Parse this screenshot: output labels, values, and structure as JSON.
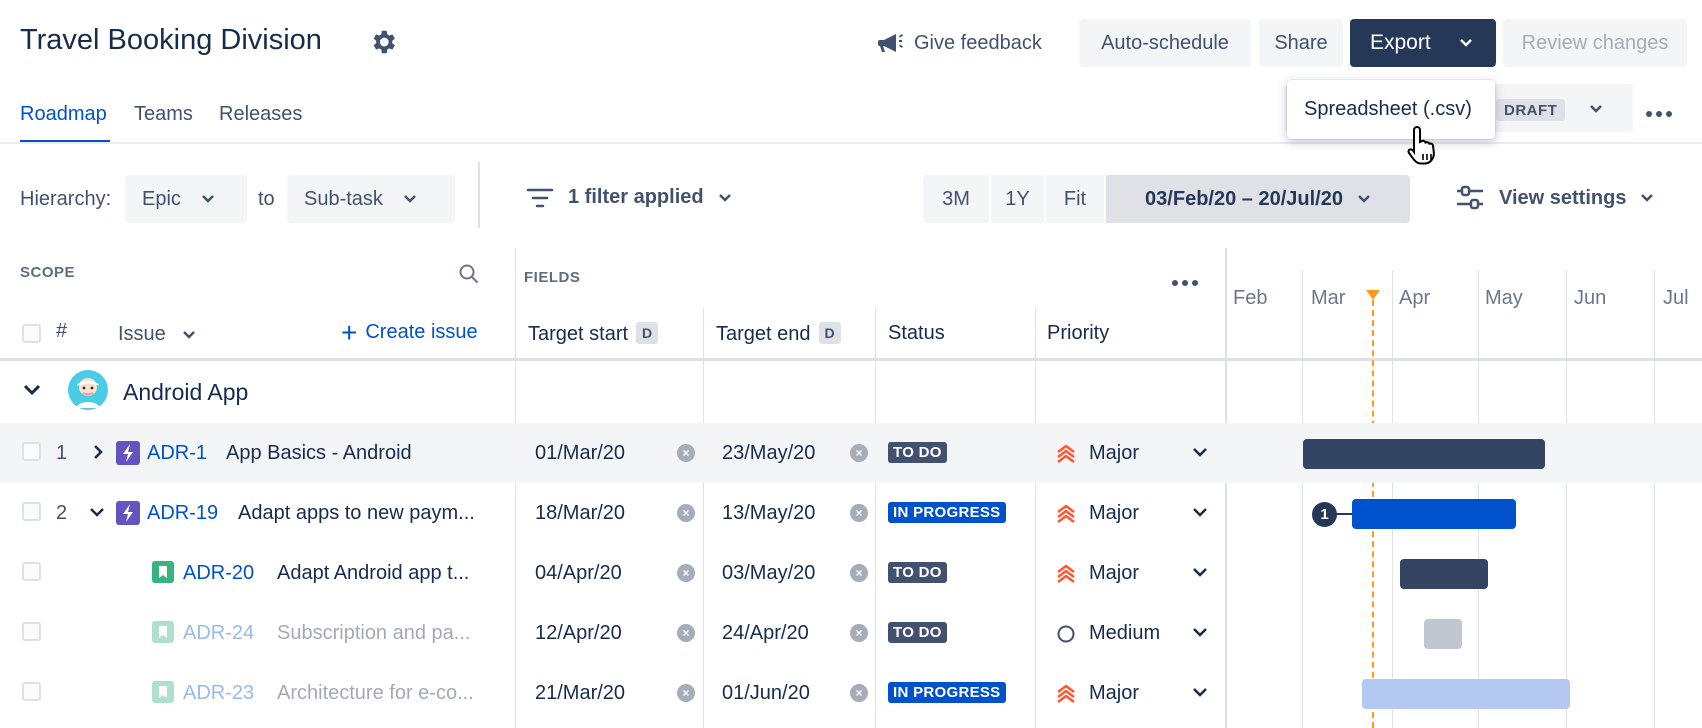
{
  "header": {
    "title": "Travel Booking Division",
    "give_feedback": "Give feedback",
    "auto_schedule": "Auto-schedule",
    "share": "Share",
    "export": "Export",
    "review_changes": "Review changes"
  },
  "tabs": [
    "Roadmap",
    "Teams",
    "Releases"
  ],
  "export_menu": {
    "item": "Spreadsheet (.csv)"
  },
  "draft_badge": "DRAFT",
  "toolbar": {
    "hierarchy_label": "Hierarchy:",
    "hierarchy_from": "Epic",
    "to_label": "to",
    "hierarchy_to": "Sub-task",
    "filter": "1 filter applied",
    "range_3m": "3M",
    "range_1y": "1Y",
    "range_fit": "Fit",
    "date_range": "03/Feb/20 – 20/Jul/20",
    "view_settings": "View settings"
  },
  "columns": {
    "scope": "SCOPE",
    "hash": "#",
    "issue": "Issue",
    "create_issue": "Create issue",
    "fields": "FIELDS",
    "target_start": "Target start",
    "target_end": "Target end",
    "d_badge": "D",
    "status": "Status",
    "priority": "Priority"
  },
  "timeline": {
    "months": [
      "Feb",
      "Mar",
      "Apr",
      "May",
      "Jun",
      "Jul"
    ]
  },
  "group": {
    "name": "Android App"
  },
  "rows": [
    {
      "num": "1",
      "key": "ADR-1",
      "summary": "App Basics - Android",
      "start": "01/Mar/20",
      "end": "23/May/20",
      "status": "TO DO",
      "priority": "Major"
    },
    {
      "num": "2",
      "key": "ADR-19",
      "summary": "Adapt apps to new paym...",
      "start": "18/Mar/20",
      "end": "13/May/20",
      "status": "IN PROGRESS",
      "priority": "Major",
      "dependency_count": "1"
    },
    {
      "num": "",
      "key": "ADR-20",
      "summary": "Adapt Android app t...",
      "start": "04/Apr/20",
      "end": "03/May/20",
      "status": "TO DO",
      "priority": "Major"
    },
    {
      "num": "",
      "key": "ADR-24",
      "summary": "Subscription and pa...",
      "start": "12/Apr/20",
      "end": "24/Apr/20",
      "status": "TO DO",
      "priority": "Medium"
    },
    {
      "num": "",
      "key": "ADR-23",
      "summary": "Architecture for e-co...",
      "start": "21/Mar/20",
      "end": "01/Jun/20",
      "status": "IN PROGRESS",
      "priority": "Major"
    }
  ],
  "colors": {
    "primary": "#0052CC",
    "dark": "#253858",
    "todo": "#42526E",
    "priority_major": "#FF5630",
    "today_line": "#FF991F",
    "epic_icon": "#6554C0",
    "story_icon": "#36B37E"
  }
}
